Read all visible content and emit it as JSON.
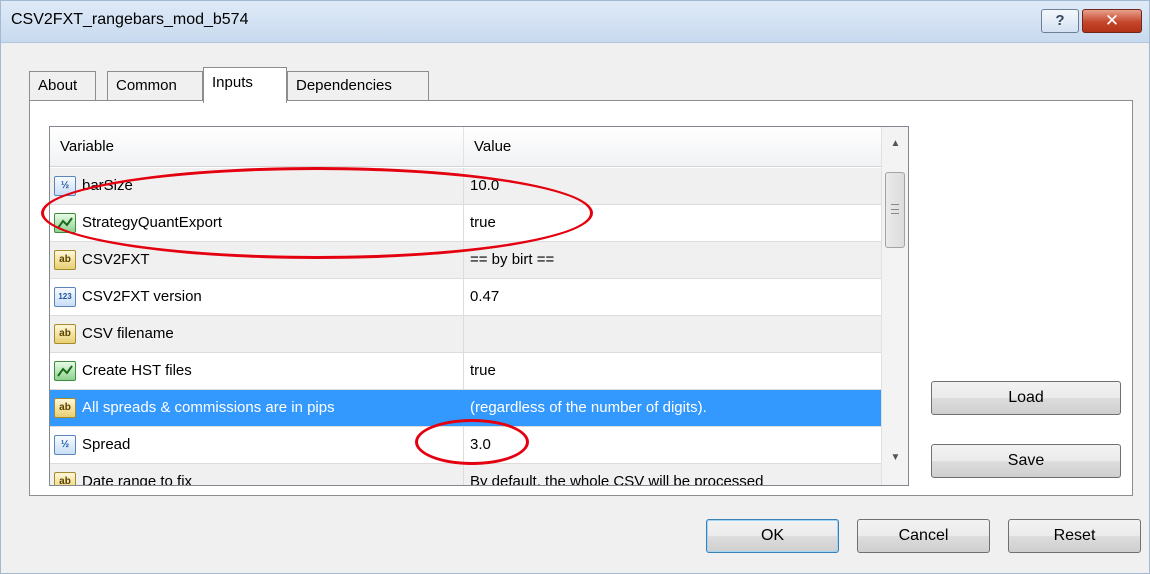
{
  "window": {
    "title": "CSV2FXT_rangebars_mod_b574",
    "help_label": "?",
    "close_label": "✕"
  },
  "tabs": [
    {
      "label": "About",
      "active": false
    },
    {
      "label": "Common",
      "active": false
    },
    {
      "label": "Inputs",
      "active": true
    },
    {
      "label": "Dependencies",
      "active": false
    }
  ],
  "grid": {
    "columns": [
      "Variable",
      "Value"
    ],
    "rows": [
      {
        "icon": "double-type-icon",
        "icon_text": "½",
        "variable": "barSize",
        "value": "10.0"
      },
      {
        "icon": "bool-type-icon",
        "icon_text": "",
        "variable": "StrategyQuantExport",
        "value": "true"
      },
      {
        "icon": "string-type-icon",
        "icon_text": "ab",
        "variable": "CSV2FXT",
        "value": "== by birt =="
      },
      {
        "icon": "int-type-icon",
        "icon_text": "123",
        "variable": "CSV2FXT version",
        "value": "0.47"
      },
      {
        "icon": "string-type-icon",
        "icon_text": "ab",
        "variable": "CSV filename",
        "value": ""
      },
      {
        "icon": "bool-type-icon",
        "icon_text": "",
        "variable": "Create HST files",
        "value": "true"
      },
      {
        "icon": "string-type-icon",
        "icon_text": "ab",
        "variable": "All spreads & commissions are in pips",
        "value": "(regardless of the number of digits)."
      },
      {
        "icon": "double-type-icon",
        "icon_text": "½",
        "variable": "Spread",
        "value": "3.0"
      },
      {
        "icon": "string-type-icon",
        "icon_text": "ab",
        "variable": "Date range to fix",
        "value": "By default, the whole CSV will be processed"
      }
    ],
    "selected_row": 6
  },
  "side_buttons": {
    "load": "Load",
    "save": "Save"
  },
  "footer_buttons": {
    "ok": "OK",
    "cancel": "Cancel",
    "reset": "Reset"
  },
  "colors": {
    "selection": "#3399ff",
    "annotation": "#e4000f"
  }
}
